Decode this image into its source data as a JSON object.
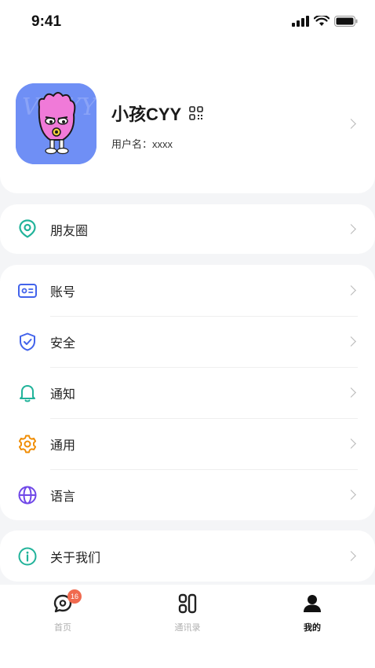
{
  "status_bar": {
    "time": "9:41"
  },
  "profile": {
    "nickname": "小孩CYY",
    "username": "用户名：xxxx"
  },
  "menu_groups": [
    {
      "items": [
        {
          "label": "朋友圈",
          "icon": "moments-icon"
        }
      ]
    },
    {
      "items": [
        {
          "label": "账号",
          "icon": "account-card-icon"
        },
        {
          "label": "安全",
          "icon": "shield-check-icon"
        },
        {
          "label": "通知",
          "icon": "bell-icon"
        },
        {
          "label": "通用",
          "icon": "gear-icon"
        },
        {
          "label": "语言",
          "icon": "globe-icon"
        }
      ]
    },
    {
      "items": [
        {
          "label": "关于我们",
          "icon": "info-icon"
        }
      ]
    }
  ],
  "tabbar": {
    "home": {
      "label": "首页",
      "badge": "16"
    },
    "contacts": {
      "label": "通讯录"
    },
    "me": {
      "label": "我的"
    }
  },
  "colors": {
    "accent": "#21b39a",
    "primary": "#4263eb",
    "badge": "#f06a4f",
    "gear": "#f08c00",
    "globe": "#7048e8"
  }
}
